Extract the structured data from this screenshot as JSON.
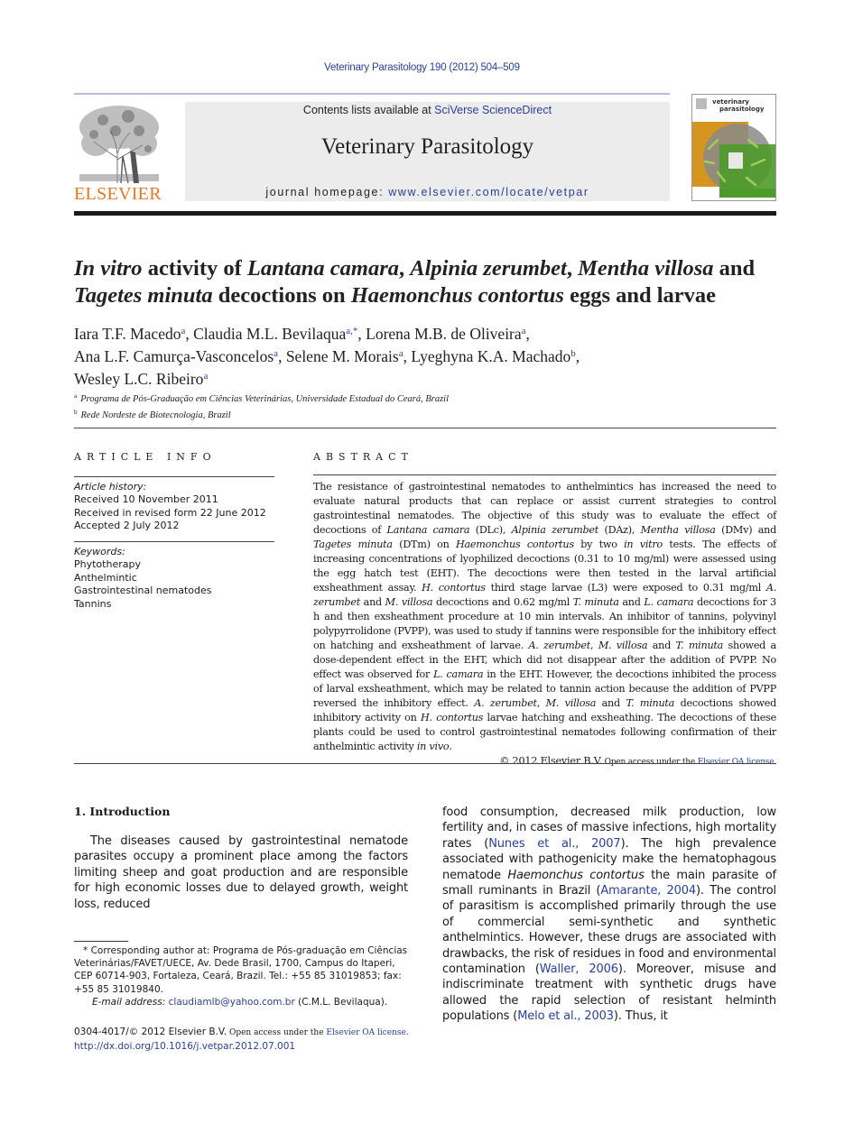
{
  "header": {
    "journal_ref": "Veterinary Parasitology 190 (2012) 504–509",
    "publisher_logo_text": "ELSEVIER",
    "contents_prefix": "Contents lists available at ",
    "contents_link": "SciVerse ScienceDirect",
    "journal_title": "Veterinary Parasitology",
    "homepage_prefix": "journal homepage: ",
    "homepage_link": "www.elsevier.com/locate/vetpar",
    "cover_title_line1": "veterinary",
    "cover_title_line2": "parasitology",
    "colors": {
      "brand_orange": "#e87722",
      "link_blue": "#2a3f9b",
      "masthead_gray": "#ececec"
    }
  },
  "article": {
    "title_parts": [
      {
        "text": "In vitro",
        "italic": true
      },
      {
        "text": " activity of ",
        "italic": false
      },
      {
        "text": "Lantana camara",
        "italic": true
      },
      {
        "text": ", ",
        "italic": false
      },
      {
        "text": "Alpinia zerumbet",
        "italic": true
      },
      {
        "text": ", ",
        "italic": false
      },
      {
        "text": "Mentha villosa",
        "italic": true
      },
      {
        "text": " and ",
        "italic": false
      },
      {
        "text": "Tagetes minuta",
        "italic": true
      },
      {
        "text": " decoctions on ",
        "italic": false
      },
      {
        "text": "Haemonchus contortus",
        "italic": true
      },
      {
        "text": " eggs and larvae",
        "italic": false
      }
    ],
    "authors": [
      {
        "name": "Iara T.F. Macedo",
        "aff": "a"
      },
      {
        "name": "Claudia M.L. Bevilaqua",
        "aff": "a,*"
      },
      {
        "name": "Lorena M.B. de Oliveira",
        "aff": "a"
      },
      {
        "name": "Ana L.F. Camurça-Vasconcelos",
        "aff": "a"
      },
      {
        "name": "Selene M. Morais",
        "aff": "a"
      },
      {
        "name": "Lyeghyna K.A. Machado",
        "aff": "b"
      },
      {
        "name": "Wesley L.C. Ribeiro",
        "aff": "a"
      }
    ],
    "affiliations": [
      {
        "mark": "a",
        "text": "Programa de Pós-Graduação em Ciências Veterinárias, Universidade Estadual do Ceará, Brazil"
      },
      {
        "mark": "b",
        "text": "Rede Nordeste de Biotecnologia, Brazil"
      }
    ]
  },
  "article_info": {
    "heading": "ARTICLE INFO",
    "history_label": "Article history:",
    "history": [
      "Received 10 November 2011",
      "Received in revised form 22 June 2012",
      "Accepted 2 July 2012"
    ],
    "keywords_label": "Keywords:",
    "keywords": [
      "Phytotherapy",
      "Anthelmintic",
      "Gastrointestinal nematodes",
      "Tannins"
    ]
  },
  "abstract": {
    "heading": "ABSTRACT",
    "parts": [
      {
        "t": "The resistance of gastrointestinal nematodes to anthelmintics has increased the need to evaluate natural products that can replace or assist current strategies to control gastrointestinal nematodes. The objective of this study was to evaluate the effect of decoctions of ",
        "i": false
      },
      {
        "t": "Lantana camara",
        "i": true
      },
      {
        "t": " (DLc), ",
        "i": false
      },
      {
        "t": "Alpinia zerumbet",
        "i": true
      },
      {
        "t": " (DAz), ",
        "i": false
      },
      {
        "t": "Mentha villosa",
        "i": true
      },
      {
        "t": " (DMv) and ",
        "i": false
      },
      {
        "t": "Tagetes minuta",
        "i": true
      },
      {
        "t": " (DTm) on ",
        "i": false
      },
      {
        "t": "Haemonchus contortus",
        "i": true
      },
      {
        "t": " by two ",
        "i": false
      },
      {
        "t": "in vitro",
        "i": true
      },
      {
        "t": " tests. The effects of increasing concentrations of lyophilized decoctions (0.31 to 10 mg/ml) were assessed using the egg hatch test (EHT). The decoctions were then tested in the larval artificial exsheathment assay. ",
        "i": false
      },
      {
        "t": "H. contortus",
        "i": true
      },
      {
        "t": " third stage larvae (L3) were exposed to 0.31 mg/ml ",
        "i": false
      },
      {
        "t": "A. zerumbet",
        "i": true
      },
      {
        "t": " and ",
        "i": false
      },
      {
        "t": "M. villosa",
        "i": true
      },
      {
        "t": " decoctions and 0.62 mg/ml ",
        "i": false
      },
      {
        "t": "T. minuta",
        "i": true
      },
      {
        "t": " and ",
        "i": false
      },
      {
        "t": "L. camara",
        "i": true
      },
      {
        "t": " decoctions for 3 h and then exsheathment procedure at 10 min intervals. An inhibitor of tannins, polyvinyl polypyrrolidone (PVPP), was used to study if tannins were responsible for the inhibitory effect on hatching and exsheathment of larvae. ",
        "i": false
      },
      {
        "t": "A. zerumbet",
        "i": true
      },
      {
        "t": ", ",
        "i": false
      },
      {
        "t": "M. villosa",
        "i": true
      },
      {
        "t": " and ",
        "i": false
      },
      {
        "t": "T. minuta",
        "i": true
      },
      {
        "t": " showed a dose-dependent effect in the EHT, which did not disappear after the addition of PVPP. No effect was observed for ",
        "i": false
      },
      {
        "t": "L. camara",
        "i": true
      },
      {
        "t": " in the EHT. However, the decoctions inhibited the process of larval exsheathment, which may be related to tannin action because the addition of PVPP reversed the inhibitory effect. ",
        "i": false
      },
      {
        "t": "A. zerumbet",
        "i": true
      },
      {
        "t": ", ",
        "i": false
      },
      {
        "t": "M. villosa",
        "i": true
      },
      {
        "t": " and ",
        "i": false
      },
      {
        "t": "T. minuta",
        "i": true
      },
      {
        "t": " decoctions showed inhibitory activity on ",
        "i": false
      },
      {
        "t": "H. contortus",
        "i": true
      },
      {
        "t": " larvae hatching and exsheathing. The decoctions of these plants could be used to control gastrointestinal nematodes following confirmation of their anthelmintic activity ",
        "i": false
      },
      {
        "t": "in vivo",
        "i": true
      },
      {
        "t": ".",
        "i": false
      }
    ],
    "copyright": "© 2012 Elsevier B.V.",
    "open_access_prefix": " Open access under the ",
    "license_link": "Elsevier OA license."
  },
  "introduction": {
    "heading": "1.  Introduction",
    "left_text": "The diseases caused by gastrointestinal nematode parasites occupy a prominent place among the factors limiting sheep and goat production and are responsible for high economic losses due to delayed growth, weight loss, reduced",
    "right_parts": [
      {
        "t": "food consumption, decreased milk production, low fertility and, in cases of massive infections, high mortality rates (",
        "k": "text"
      },
      {
        "t": "Nunes et al., 2007",
        "k": "link"
      },
      {
        "t": "). The high prevalence associated with pathogenicity make the hematophagous nematode ",
        "k": "text"
      },
      {
        "t": "Haemonchus contortus",
        "k": "italic"
      },
      {
        "t": " the main parasite of small ruminants in Brazil (",
        "k": "text"
      },
      {
        "t": "Amarante, 2004",
        "k": "link"
      },
      {
        "t": "). The control of parasitism is accomplished primarily through the use of commercial semi-synthetic and synthetic anthelmintics. However, these drugs are associated with drawbacks, the risk of residues in food and environmental contamination (",
        "k": "text"
      },
      {
        "t": "Waller, 2006",
        "k": "link"
      },
      {
        "t": "). Moreover, misuse and indiscriminate treatment with synthetic drugs have allowed the rapid selection of resistant helminth populations (",
        "k": "text"
      },
      {
        "t": "Melo et al., 2003",
        "k": "link"
      },
      {
        "t": "). Thus, it",
        "k": "text"
      }
    ]
  },
  "footnote": {
    "star_text": "*  Corresponding author at: Programa de Pós-graduação em Ciências Veterinárias/FAVET/UECE, Av. Dede Brasil, 1700, Campus do Itaperi, CEP 60714-903, Fortaleza, Ceará, Brazil. Tel.: +55 85 31019853; fax: +55 85 31019840.",
    "email_label": "E-mail address: ",
    "email": "claudiamlb@yahoo.com.br",
    "email_suffix": " (C.M.L. Bevilaqua)."
  },
  "issn": {
    "line1_prefix": "0304-4017/© 2012 Elsevier B.V.",
    "open_access_prefix": " Open access under the ",
    "license_link": "Elsevier OA license.",
    "doi": "http://dx.doi.org/10.1016/j.vetpar.2012.07.001"
  }
}
